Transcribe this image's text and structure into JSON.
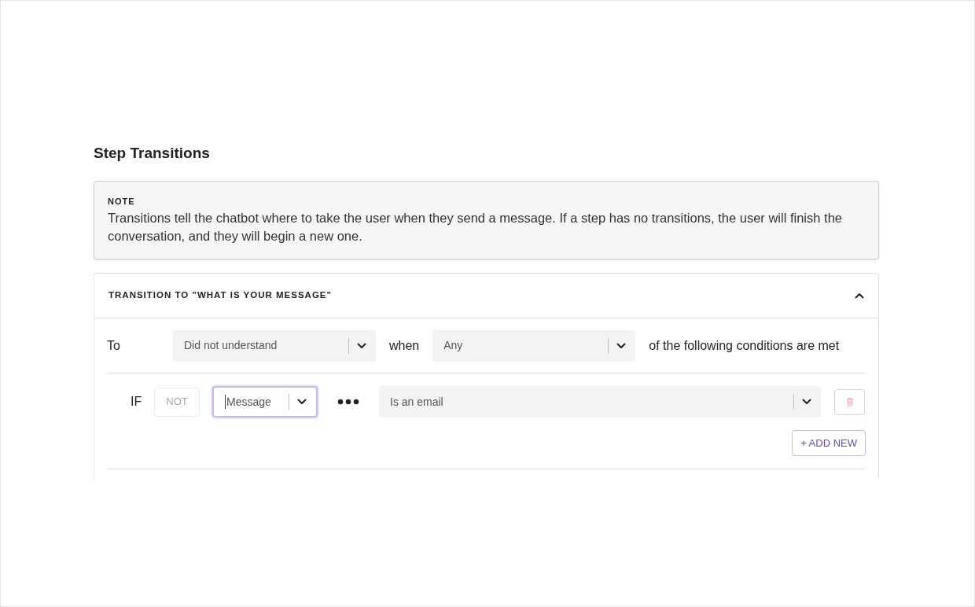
{
  "title": "Step Transitions",
  "note": {
    "label": "NOTE",
    "text": "Transitions tell the chatbot where to take the user when they send a message. If a step has no transitions, the user will finish the conversation, and they will begin a new one."
  },
  "transition": {
    "title": "TRANSITION TO \"WHAT IS YOUR MESSAGE\"",
    "expanded": true,
    "to_label": "To",
    "to_value": "Did not understand",
    "when_label": "when",
    "when_value": "Any",
    "suffix": "of the following conditions are met",
    "conditions": [
      {
        "if_label": "IF",
        "not": {
          "label": "NOT",
          "on": false
        },
        "field": {
          "value": "Message",
          "focused": true
        },
        "operator": "Is an email"
      }
    ],
    "add_button": "+ ADD NEW"
  }
}
